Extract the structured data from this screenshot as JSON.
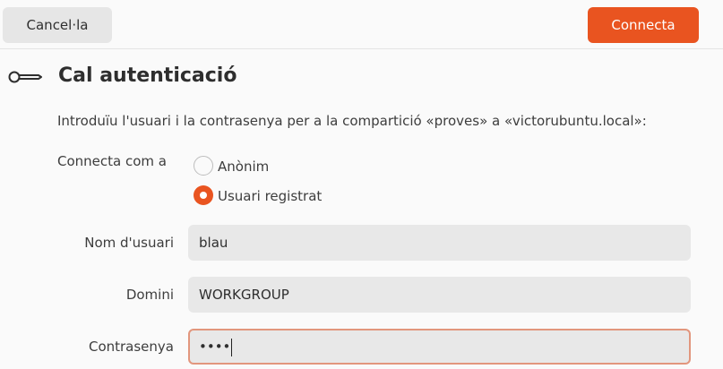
{
  "header": {
    "cancel_label": "Cancel·la",
    "connect_label": "Connecta",
    "accent_color": "#e95420"
  },
  "dialog": {
    "icon": "key-icon",
    "title": "Cal autenticació",
    "intro": "Introduïu l'usuari i la contrasenya per a la compartició «proves» a «victorubuntu.local»:"
  },
  "connect_as": {
    "label": "Connecta com a",
    "options": [
      {
        "label": "Anònim",
        "selected": false
      },
      {
        "label": "Usuari registrat",
        "selected": true
      }
    ]
  },
  "fields": {
    "username": {
      "label": "Nom d'usuari",
      "value": "blau"
    },
    "domain": {
      "label": "Domini",
      "value": "WORKGROUP"
    },
    "password": {
      "label": "Contrasenya",
      "value": "••••",
      "focused": true
    }
  }
}
